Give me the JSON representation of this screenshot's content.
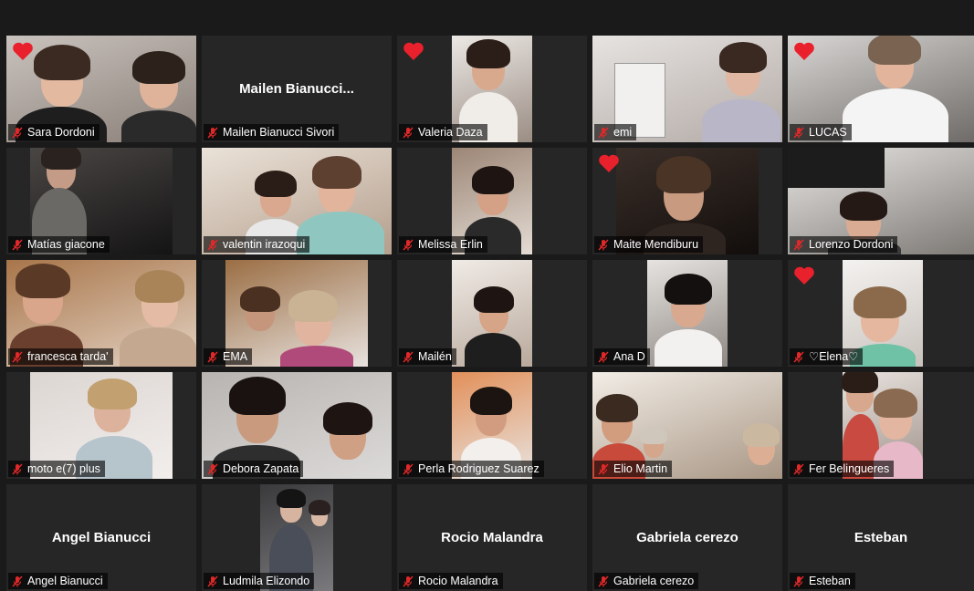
{
  "colors": {
    "background": "#1a1a1a",
    "tile": "#262626",
    "mute": "#e02828",
    "heart": "#e8212c"
  },
  "participants": [
    {
      "name": "Sara Dordoni",
      "heart": true
    },
    {
      "name": "Mailen Bianucci Sivori",
      "display_name": "Mailen  Bianucci..."
    },
    {
      "name": "Valeria Daza",
      "heart": true
    },
    {
      "name": "emi"
    },
    {
      "name": "LUCAS",
      "heart": true
    },
    {
      "name": "Matías giacone"
    },
    {
      "name": "valentin irazoqui"
    },
    {
      "name": "Melissa Erlin"
    },
    {
      "name": "Maite Mendiburu",
      "heart": true
    },
    {
      "name": "Lorenzo Dordoni"
    },
    {
      "name": "francesca tarda'"
    },
    {
      "name": "EMA"
    },
    {
      "name": "Mailén"
    },
    {
      "name": "Ana D"
    },
    {
      "name": "♡Elena♡",
      "heart": true
    },
    {
      "name": "moto e(7) plus"
    },
    {
      "name": "Debora Zapata"
    },
    {
      "name": "Perla Rodriguez Suarez"
    },
    {
      "name": "Elio Martin"
    },
    {
      "name": "Fer Belingueres"
    },
    {
      "name": "Angel Bianucci",
      "display_name": "Angel Bianucci"
    },
    {
      "name": "Ludmila Elizondo"
    },
    {
      "name": "Rocio Malandra",
      "display_name": "Rocio Malandra"
    },
    {
      "name": "Gabriela cerezo",
      "display_name": "Gabriela cerezo"
    },
    {
      "name": "Esteban",
      "display_name": "Esteban"
    }
  ]
}
